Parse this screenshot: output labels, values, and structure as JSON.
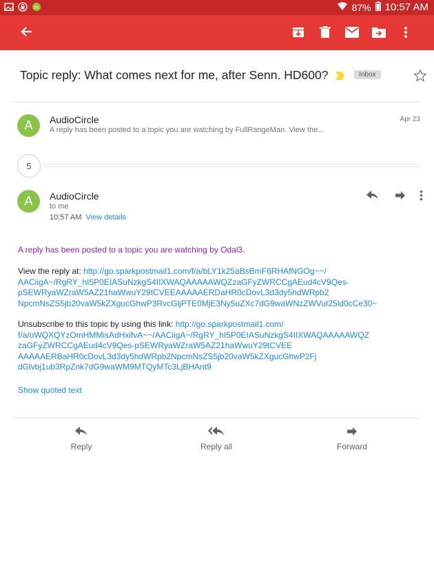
{
  "status_bar": {
    "battery": "87%",
    "time": "10:57 AM"
  },
  "email": {
    "subject": "Topic reply: What comes next for me, after Senn. HD600?",
    "label": "Inbox"
  },
  "messages": [
    {
      "avatar_letter": "A",
      "sender": "AudioCircle",
      "snippet": "A reply has been posted to a topic you are watching by FullRangeMan. View the...",
      "date": "Apr 23"
    },
    {
      "avatar_letter": "A",
      "sender": "AudioCircle",
      "to": "to me",
      "time": "10:57 AM",
      "view_details": "View details"
    }
  ],
  "collapsed_count": "5",
  "body": {
    "intro": "A reply has been posted to a topic you are watching by Odal3.",
    "view_label": "View the reply at: ",
    "view_link_lines": [
      "http://go.sparkpostmail1.com/f/a/bLY1k25aBsBmF6RHAfNGOg~~/",
      "AACiigA~/RgRY_hI5P0EIASuNzkgS4IIXWAQAAAAAWQZzaGFyZWRCCgAEud4cV9Qes-",
      "pSEWRyaWZraW5AZ21haWwuY29tCVEEAAAAAERDaHR0cDovL3d3dy5hdWRpb2",
      "NpcmNsZS5jb20vaW5kZXgucGhwP3RvcGljPTE0MjE3Ny5uZXc7dG9waWNzZWVuI25ld0cCe30~"
    ],
    "unsub_label": "Unsubscribe to this topic by using this link: ",
    "unsub_link_lines": [
      "http://go.sparkpostmail1.com/",
      "f/a/oWQXQYzOmHMMisAdHxifvA~~/AACiigA~/RgRY_hI5P0EIASuNzkgS4IIXWAQAAAAAWQZ",
      "zaGFyZWRCCgAEud4cV9Qes-pSEWRyaWZraW5AZ21haWwuY29tCVEE",
      "AAAAAERBaHR0cDovL3d3dy5hdWRpb2NpcmNsZS5jb20vaW5kZXgucGhwP2Fj",
      "dGlvbj1ub3RpZnk7dG9waWM9MTQyMTc3LjBHAnt9"
    ],
    "show_quoted": "Show quoted text"
  },
  "bottom_actions": {
    "reply": "Reply",
    "reply_all": "Reply all",
    "forward": "Forward"
  },
  "colors": {
    "app_bar": "#e53935",
    "status_bar": "#c62828",
    "avatar": "#8bc34a",
    "link": "#1e88e5",
    "purple_text": "#8e24aa"
  }
}
